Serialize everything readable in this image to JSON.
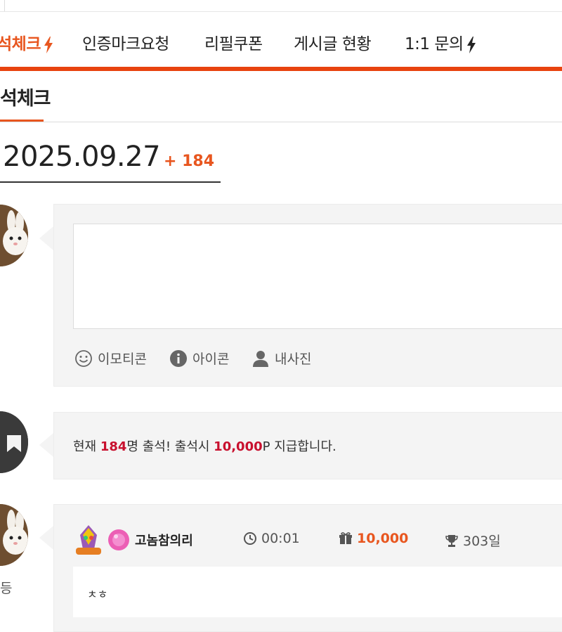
{
  "nav": {
    "items": [
      {
        "label": "석체크",
        "active": true,
        "bolt": true
      },
      {
        "label": "인증마크요청",
        "active": false,
        "bolt": false
      },
      {
        "label": "리필쿠폰",
        "active": false,
        "bolt": false
      },
      {
        "label": "게시글 현황",
        "active": false,
        "bolt": false
      },
      {
        "label": "1:1 문의",
        "active": false,
        "bolt": true
      }
    ],
    "accent": "#e8430f"
  },
  "section": {
    "title": "석체크"
  },
  "date": {
    "value": "2025.09.27",
    "count": "+ 184"
  },
  "write": {
    "tools": [
      {
        "icon": "smile-icon",
        "label": "이모티콘"
      },
      {
        "icon": "info-icon",
        "label": "아이콘"
      },
      {
        "icon": "person-icon",
        "label": "내사진"
      }
    ]
  },
  "notice": {
    "prefix": "현재 ",
    "count": "184",
    "mid": "명 출석! 출석시 ",
    "points": "10,000",
    "suffix": "P 지급합니다."
  },
  "entry": {
    "username": "고놈참의리",
    "time": "00:01",
    "points": "10,000",
    "days": "303일",
    "rank": "등",
    "comment": "ㅊㅎ"
  }
}
